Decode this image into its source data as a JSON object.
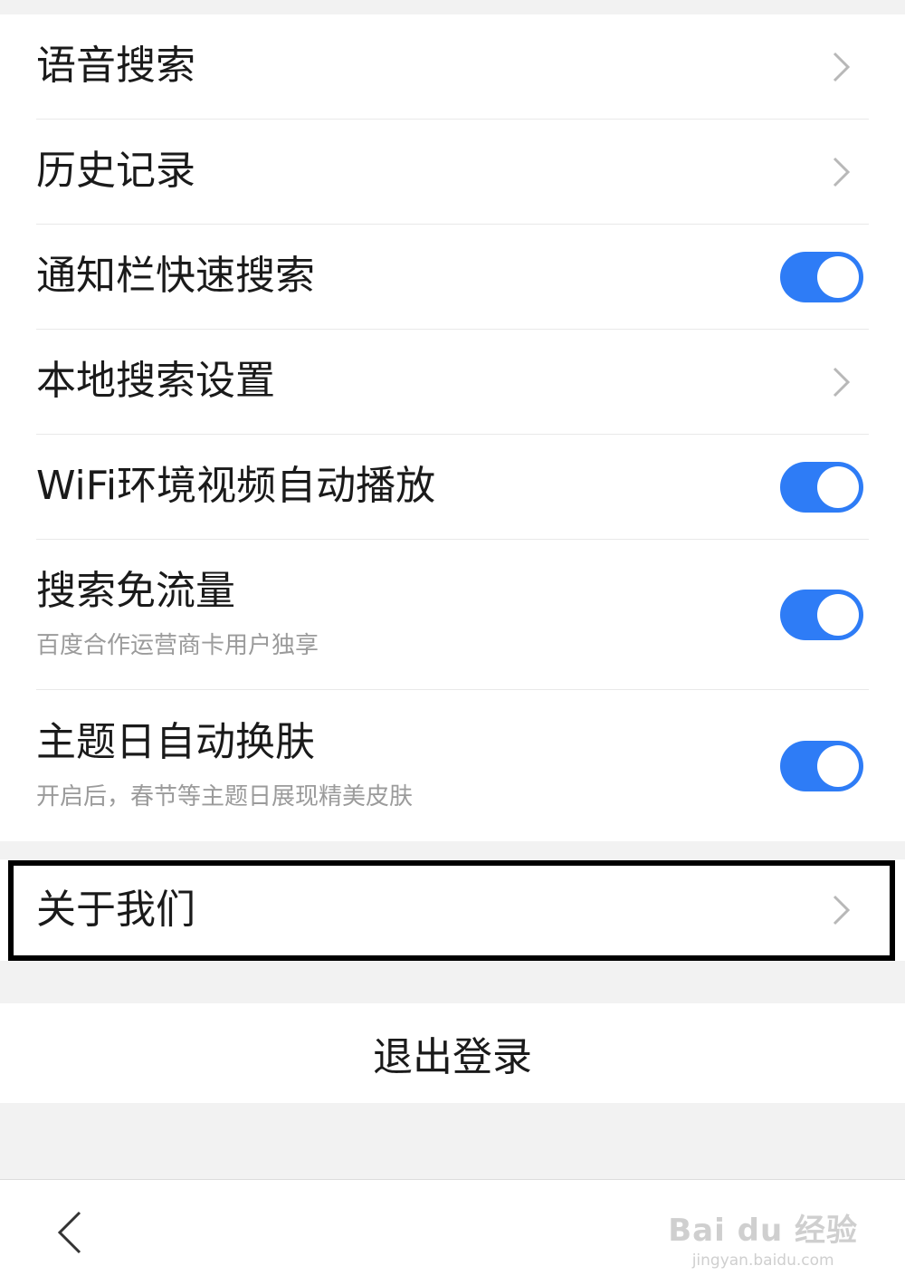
{
  "settings": {
    "items": [
      {
        "label": "语音搜索",
        "control": "chevron-right-icon"
      },
      {
        "label": "历史记录",
        "control": "chevron-right-icon"
      },
      {
        "label": "通知栏快速搜索",
        "control": "toggle",
        "on": true
      },
      {
        "label": "本地搜索设置",
        "control": "chevron-right-icon"
      },
      {
        "label": "WiFi环境视频自动播放",
        "control": "toggle",
        "on": true
      },
      {
        "label": "搜索免流量",
        "sublabel": "百度合作运营商卡用户独享",
        "control": "toggle",
        "on": true
      },
      {
        "label": "主题日自动换肤",
        "sublabel": "开启后，春节等主题日展现精美皮肤",
        "control": "toggle",
        "on": true
      }
    ],
    "about": {
      "label": "关于我们",
      "control": "chevron-right-icon"
    }
  },
  "logout_label": "退出登录",
  "bottom_bar": {
    "back_icon": "chevron-left-icon",
    "watermark_main": "Bai du 经验",
    "watermark_sub": "jingyan.baidu.com"
  },
  "colors": {
    "toggle_on": "#2e7cf6",
    "background": "#f2f2f2",
    "highlight_border": "#000000"
  }
}
